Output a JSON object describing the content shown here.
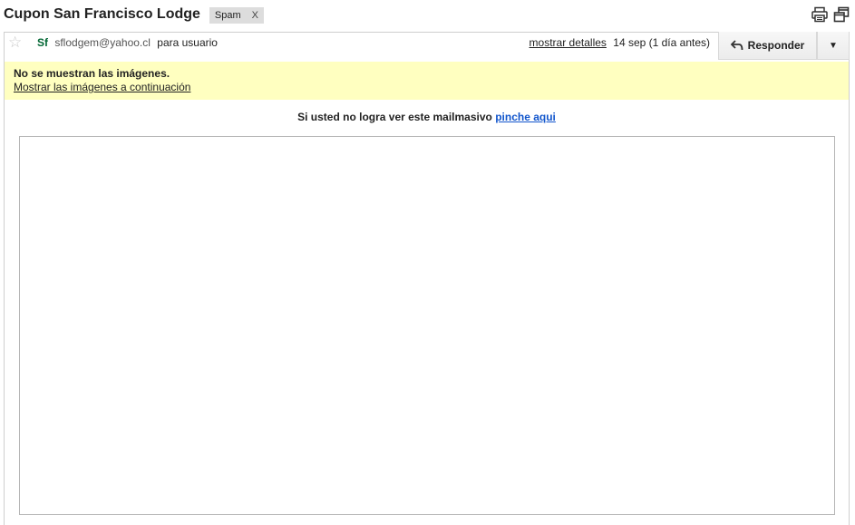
{
  "subject": {
    "title": "Cupon San Francisco Lodge",
    "label": "Spam",
    "label_remove": "X"
  },
  "toolbar": {
    "print_icon": "print-icon",
    "new_window_icon": "new-window-icon"
  },
  "message": {
    "star_glyph": "☆",
    "sender_short": "Sf",
    "sender_email": "sflodgem@yahoo.cl",
    "recipient": "para usuario",
    "details_link": "mostrar detalles",
    "date": "14 sep (1 día antes)",
    "reply_label": "Responder",
    "more_glyph": "▼"
  },
  "images_notice": {
    "title": "No se muestran las imágenes.",
    "link": "Mostrar las imágenes a continuación"
  },
  "body": {
    "intro_text": "Si usted no logra ver este mailmasivo",
    "link_text": "pinche aqui"
  },
  "colors": {
    "sender_name": "#006633",
    "link": "#1155cc",
    "notice_bg": "#ffffc0",
    "chip_bg": "#dddddd"
  }
}
